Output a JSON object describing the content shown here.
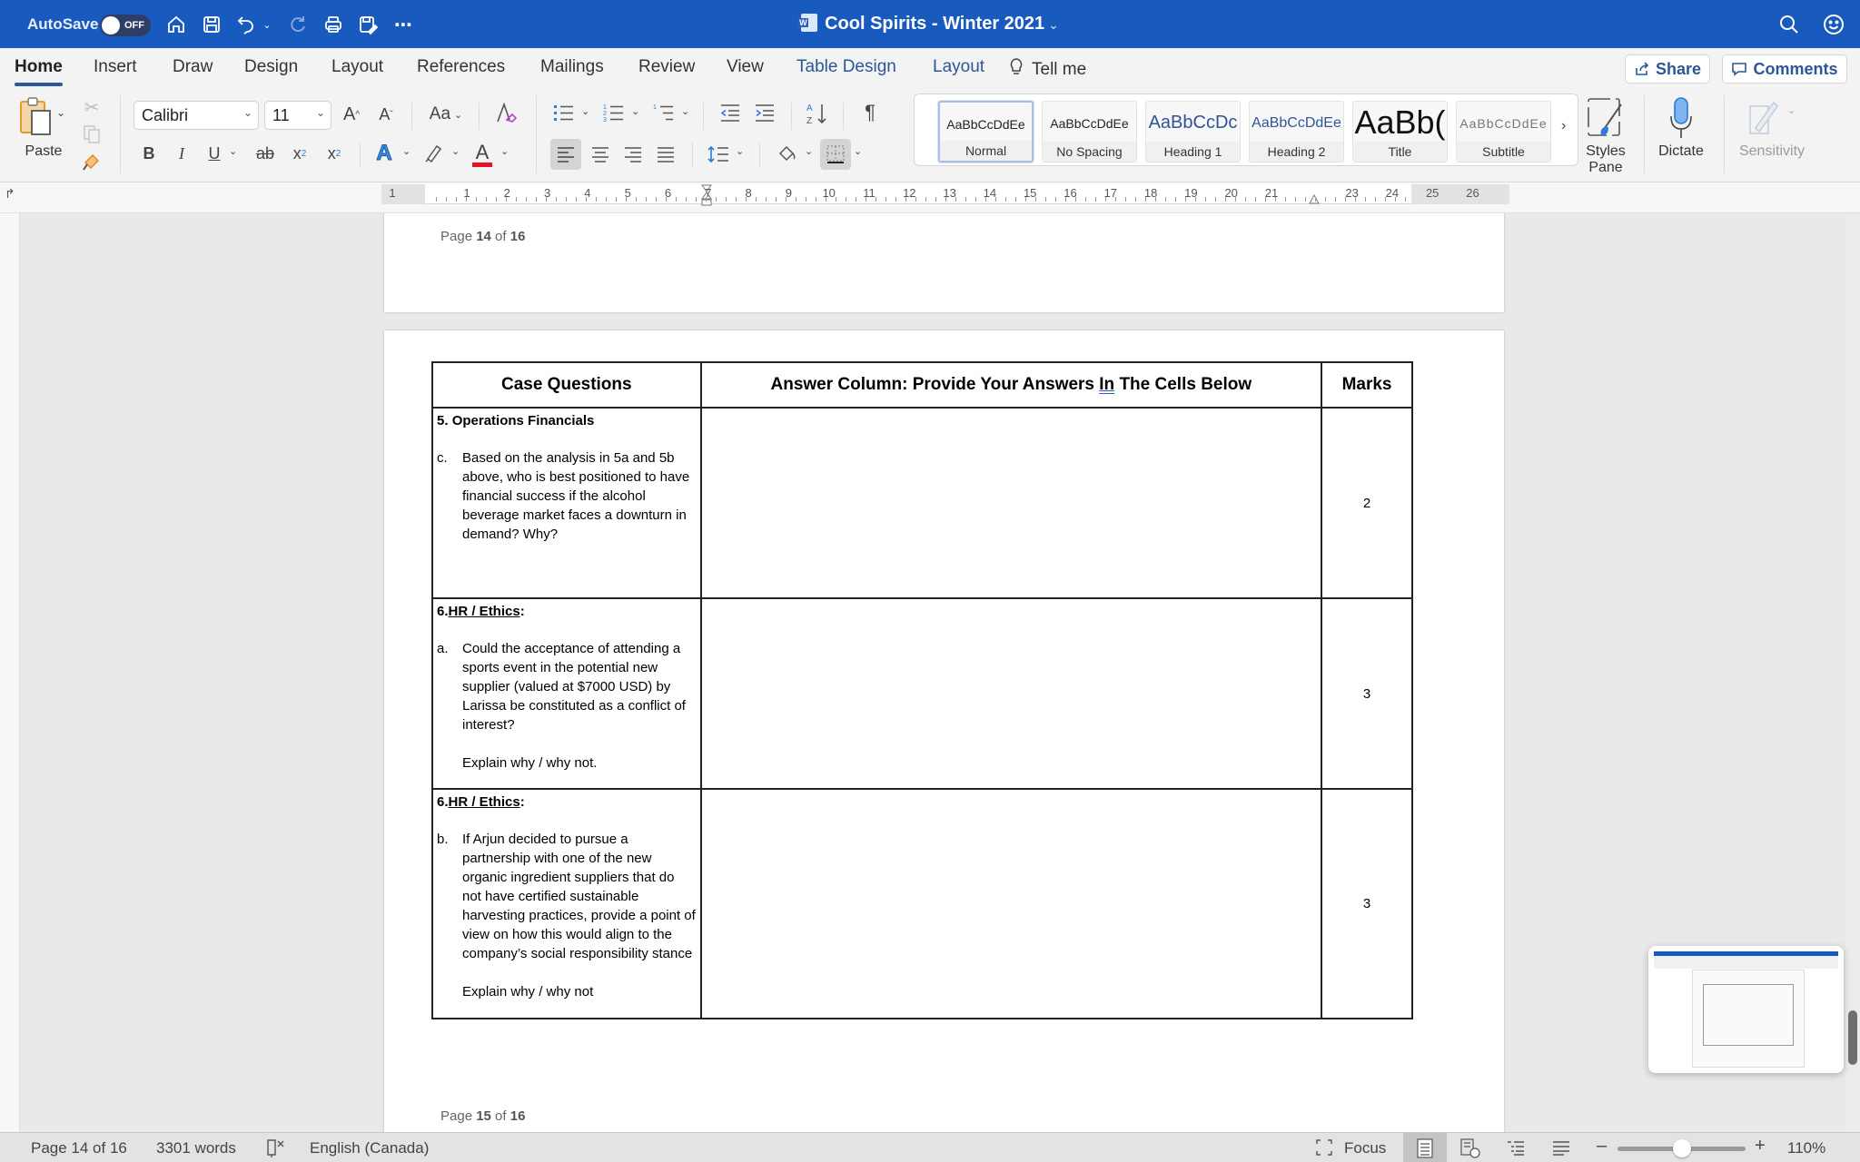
{
  "titlebar": {
    "autosave_label": "AutoSave",
    "autosave_state": "OFF",
    "doc_title": "Cool Spirits - Winter 2021",
    "quick_access": [
      "home-icon",
      "save-icon",
      "undo-icon",
      "undo-dropdown-icon",
      "redo-icon",
      "print-icon",
      "save-as-edit-icon",
      "more-icon"
    ],
    "right_icons": [
      "search-icon",
      "feedback-smiley-icon"
    ]
  },
  "tabs": {
    "items": [
      {
        "label": "Home",
        "active": true
      },
      {
        "label": "Insert"
      },
      {
        "label": "Draw"
      },
      {
        "label": "Design"
      },
      {
        "label": "Layout"
      },
      {
        "label": "References"
      },
      {
        "label": "Mailings"
      },
      {
        "label": "Review"
      },
      {
        "label": "View"
      },
      {
        "label": "Table Design",
        "contextual": true
      },
      {
        "label": "Layout",
        "contextual": true
      }
    ],
    "tell_me": "Tell me",
    "share": "Share",
    "comments": "Comments"
  },
  "ribbon": {
    "paste_label": "Paste",
    "font_name": "Calibri",
    "font_size": "11",
    "change_case": "Aa",
    "styles": [
      {
        "sample": "AaBbCcDdEe",
        "name": "Normal",
        "selected": true
      },
      {
        "sample": "AaBbCcDdEe",
        "name": "No Spacing"
      },
      {
        "sample": "AaBbCcDc",
        "name": "Heading 1"
      },
      {
        "sample": "AaBbCcDdEe",
        "name": "Heading 2"
      },
      {
        "sample": "AaBb(",
        "name": "Title"
      },
      {
        "sample": "AaBbCcDdEe",
        "name": "Subtitle"
      }
    ],
    "styles_pane": "Styles Pane",
    "dictate": "Dictate",
    "sensitivity": "Sensitivity",
    "colors": {
      "font_color": "#e81123",
      "accent": "#2b579a"
    }
  },
  "ruler": {
    "numbers": [
      "1",
      "1",
      "2",
      "3",
      "4",
      "5",
      "6",
      "7",
      "8",
      "9",
      "10",
      "11",
      "12",
      "13",
      "14",
      "15",
      "16",
      "17",
      "18",
      "19",
      "20",
      "21",
      "23",
      "24",
      "25",
      "26"
    ]
  },
  "document": {
    "page14_footer": {
      "prefix": "Page ",
      "page": "14",
      "mid": " of ",
      "total": "16"
    },
    "page15_footer": {
      "prefix": "Page ",
      "page": "15",
      "mid": " of ",
      "total": "16"
    },
    "table": {
      "headers": {
        "questions": "Case Questions",
        "answer_pre": "Answer Column:  Provide Your Answers ",
        "answer_in": "In",
        "answer_post": " The Cells Below",
        "marks": "Marks"
      },
      "rows": [
        {
          "section_num": "5. ",
          "section_title": "Operations Financials",
          "section_suffix": "",
          "letter": "c.",
          "question": "Based on the analysis in 5a and 5b above, who is best positioned to have financial success if the alcohol beverage market faces a downturn in demand?  Why?",
          "explain": "",
          "answer": "",
          "marks": "2"
        },
        {
          "section_num": "6.",
          "section_title": "HR / Ethics",
          "section_suffix": ":",
          "letter": "a.",
          "question": "Could the acceptance of attending a sports event in the potential new supplier (valued at $7000 USD) by Larissa be constituted as a conflict of interest?",
          "explain": "Explain why / why not.",
          "answer": "",
          "marks": "3"
        },
        {
          "section_num": "6.",
          "section_title": "HR / Ethics",
          "section_suffix": ":",
          "letter": "b.",
          "question": "If Arjun decided to pursue a partnership with one of the new organic ingredient suppliers that do not have certified sustainable harvesting practices, provide a point of view on how this would align to the company’s social responsibility stance",
          "explain": "Explain why / why not",
          "answer": "",
          "marks": "3"
        }
      ]
    }
  },
  "statusbar": {
    "page": "Page 14 of 16",
    "words": "3301 words",
    "language": "English (Canada)",
    "focus": "Focus",
    "zoom": "110%",
    "zoom_percent": 110
  }
}
